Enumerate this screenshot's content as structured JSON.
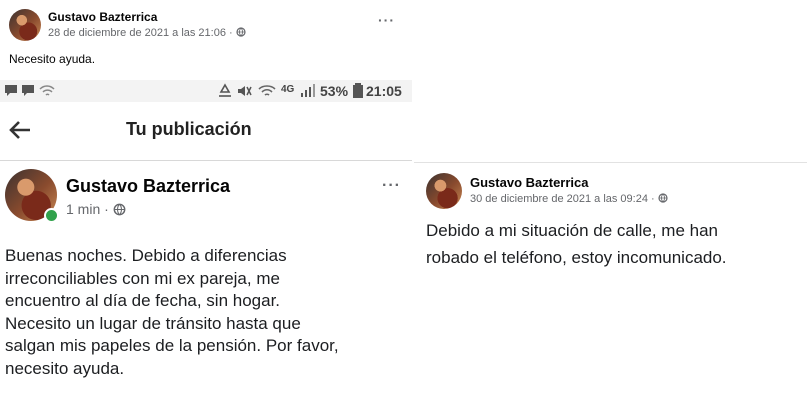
{
  "post_top": {
    "author": "Gustavo Bazterrica",
    "timestamp": "28 de diciembre de 2021 a las 21:06 ·",
    "body": "Necesito ayuda.",
    "more": "···"
  },
  "status_bar": {
    "battery": "53%",
    "time": "21:05",
    "network": "4G"
  },
  "app_header": {
    "title": "Tu publicación"
  },
  "post_main": {
    "author": "Gustavo Bazterrica",
    "timestamp": "1 min ·",
    "more": "···",
    "lines": [
      "Buenas noches. Debido a diferencias",
      "irreconciliables con mi ex pareja, me",
      "encuentro al día de fecha, sin hogar.",
      "Necesito un lugar de tránsito hasta que",
      "salgan mis papeles de la pensión. Por favor,",
      "necesito ayuda."
    ]
  },
  "post_right": {
    "author": "Gustavo Bazterrica",
    "timestamp": "30 de diciembre de 2021 a las 09:24 ·",
    "lines": [
      "Debido a mi situación de calle, me han",
      "robado el teléfono, estoy incomunicado."
    ]
  },
  "icons": [
    "globe-icon",
    "more-icon",
    "back-arrow-icon",
    "chat-icon",
    "wifi-icon",
    "signal-icon",
    "battery-icon"
  ]
}
